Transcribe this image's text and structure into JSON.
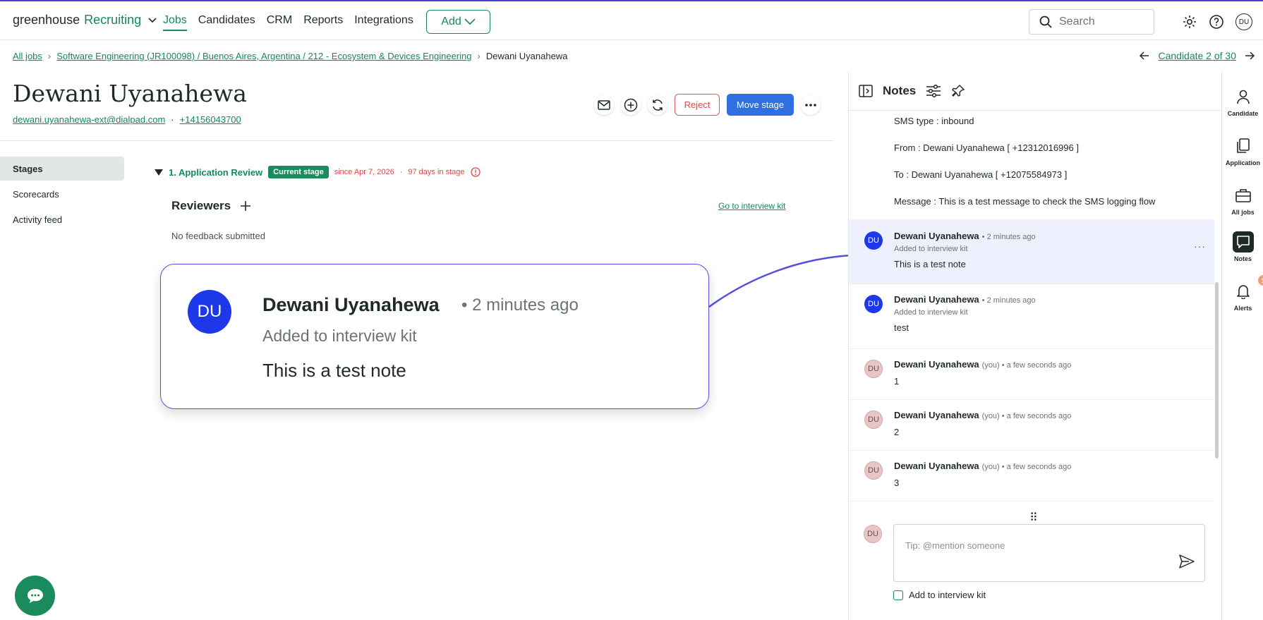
{
  "app": {
    "brand_main": "greenhouse",
    "brand_sub": "Recruiting"
  },
  "nav": {
    "items": [
      "Jobs",
      "Candidates",
      "CRM",
      "Reports",
      "Integrations"
    ],
    "add_label": "Add"
  },
  "search": {
    "placeholder": "Search"
  },
  "user": {
    "initials": "DU"
  },
  "breadcrumb": {
    "all_jobs": "All jobs",
    "job": "Software Engineering (JR100098) / Buenos Aires, Argentina / 212 - Ecosystem & Devices Engineering",
    "current": "Dewani Uyanahewa"
  },
  "candidate_nav": {
    "label": "Candidate 2 of 30"
  },
  "candidate": {
    "name": "Dewani Uyanahewa",
    "email": "dewani.uyanahewa-ext@dialpad.com",
    "phone": "+14156043700"
  },
  "actions": {
    "reject": "Reject",
    "move_stage": "Move stage"
  },
  "side_nav": {
    "items": [
      "Stages",
      "Scorecards",
      "Activity feed"
    ]
  },
  "stage": {
    "title": "1. Application Review",
    "badge": "Current stage",
    "since": "since Apr 7, 2026",
    "days": "97 days in stage",
    "reviewers": "Reviewers",
    "go_kit": "Go to interview kit",
    "no_feedback": "No feedback submitted"
  },
  "callout": {
    "initials": "DU",
    "name": "Dewani Uyanahewa",
    "time": "• 2 minutes ago",
    "added": "Added to interview kit",
    "text": "This is a test note"
  },
  "notes_panel": {
    "title": "Notes",
    "sms": {
      "type": "SMS type : inbound",
      "from": "From : Dewani Uyanahewa [ +12312016996 ]",
      "to": "To : Dewani Uyanahewa [ +12075584973 ]",
      "message": "Message : This is a test message to check the SMS logging flow"
    },
    "notes": [
      {
        "initials": "DU",
        "author": "Dewani Uyanahewa",
        "meta": "• 2 minutes ago",
        "added": "Added to interview kit",
        "body": "This is a test note"
      },
      {
        "initials": "DU",
        "author": "Dewani Uyanahewa",
        "meta": "• 2 minutes ago",
        "added": "Added to interview kit",
        "body": "test"
      },
      {
        "initials": "DU",
        "author": "Dewani Uyanahewa",
        "meta": "(you) • a few seconds ago",
        "body": "1"
      },
      {
        "initials": "DU",
        "author": "Dewani Uyanahewa",
        "meta": "(you) • a few seconds ago",
        "body": "2"
      },
      {
        "initials": "DU",
        "author": "Dewani Uyanahewa",
        "meta": "(you) • a few seconds ago",
        "body": "3"
      }
    ],
    "composer_placeholder": "Tip: @mention someone",
    "composer_initials": "DU",
    "add_to_kit": "Add to interview kit"
  },
  "rail": {
    "candidate": "Candidate",
    "application": "Application",
    "all_jobs": "All jobs",
    "notes": "Notes",
    "alerts": "Alerts",
    "alerts_count": "1"
  },
  "colors": {
    "brand_green": "#15885f",
    "primary_blue": "#2f6fdf",
    "reject_red": "#e04646",
    "callout_border": "#5550dc"
  }
}
